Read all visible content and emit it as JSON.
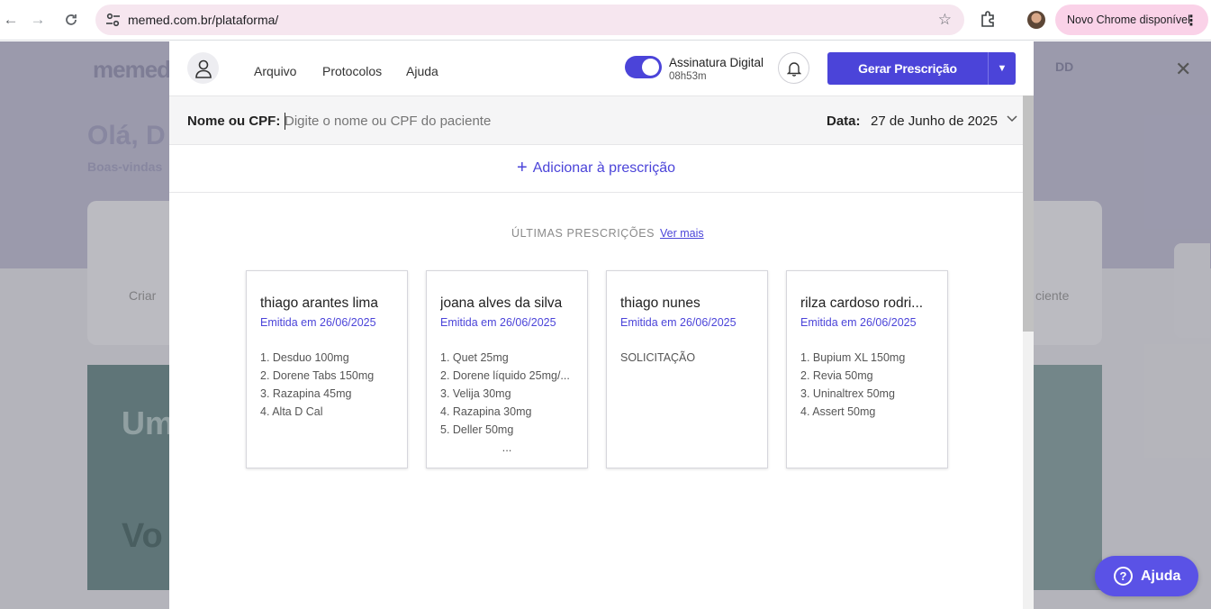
{
  "browser": {
    "url": "memed.com.br/plataforma/",
    "update_label": "Novo Chrome disponível"
  },
  "background": {
    "logo": "memed",
    "greeting": "Olá, D",
    "subtitle": "Boas-vindas",
    "card_left": "Criar",
    "card_right": "ciente",
    "banner_text": "Um trat",
    "banner_text2": "Vo",
    "initials": "DD"
  },
  "header": {
    "menu": [
      "Arquivo",
      "Protocolos",
      "Ajuda"
    ],
    "signature_title": "Assinatura Digital",
    "signature_time": "08h53m",
    "signature_enabled": true,
    "generate_label": "Gerar Prescrição"
  },
  "patient": {
    "label": "Nome ou CPF:",
    "placeholder": "Digite o nome ou CPF do paciente",
    "date_label": "Data:",
    "date_value": "27 de Junho de 2025"
  },
  "add_prescription_label": "Adicionar à prescrição",
  "recent": {
    "title": "ÚLTIMAS PRESCRIÇÕES",
    "see_more": "Ver mais",
    "cards": [
      {
        "name": "thiago arantes lima",
        "emitted": "Emitida em 26/06/2025",
        "items": [
          "1. Desduo 100mg",
          "2. Dorene Tabs 150mg",
          "3. Razapina 45mg",
          "4. Alta D Cal"
        ],
        "more": ""
      },
      {
        "name": "joana alves da silva",
        "emitted": "Emitida em 26/06/2025",
        "items": [
          "1. Quet 25mg",
          "2. Dorene líquido 25mg/...",
          "3. Velija 30mg",
          "4. Razapina 30mg",
          "5. Deller 50mg"
        ],
        "more": "..."
      },
      {
        "name": "thiago nunes",
        "emitted": "Emitida em 26/06/2025",
        "items": [
          "SOLICITAÇÃO"
        ],
        "more": ""
      },
      {
        "name": "rilza cardoso rodri...",
        "emitted": "Emitida em 26/06/2025",
        "items": [
          "1. Bupium XL 150mg",
          "2. Revia 50mg",
          "3. Uninaltrex 50mg",
          "4. Assert 50mg"
        ],
        "more": ""
      }
    ]
  },
  "help_label": "Ajuda",
  "colors": {
    "accent": "#4b44d9",
    "help_button": "#5a52e6",
    "update_pill": "#fad2e8"
  }
}
